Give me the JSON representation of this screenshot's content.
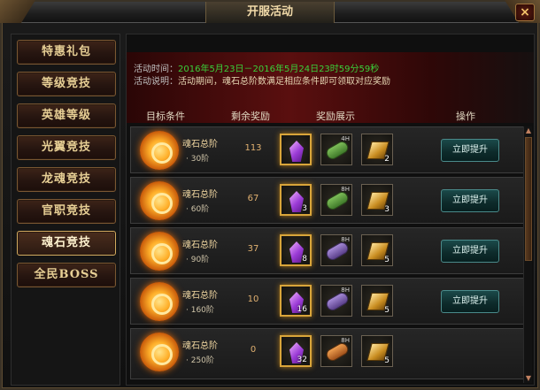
{
  "window": {
    "title": "开服活动",
    "close_label": "×"
  },
  "sidebar": {
    "items": [
      {
        "label": "特惠礼包",
        "active": false
      },
      {
        "label": "等级竞技",
        "active": false
      },
      {
        "label": "英雄等级",
        "active": false
      },
      {
        "label": "光翼竞技",
        "active": false
      },
      {
        "label": "龙魂竞技",
        "active": false
      },
      {
        "label": "官职竞技",
        "active": false
      },
      {
        "label": "魂石竞技",
        "active": true
      },
      {
        "label": "全民BOSS",
        "active": false
      }
    ]
  },
  "activity": {
    "time_label": "活动时间：",
    "time_value": "2016年5月23日－2016年5月24日23时59分59秒",
    "desc_label": "活动说明：",
    "desc_value": "活动期间，魂石总阶数满足相应条件即可领取对应奖励"
  },
  "table": {
    "headers": {
      "condition": "目标条件",
      "remaining": "剩余奖励",
      "rewards": "奖励展示",
      "action": "操作"
    },
    "rows": [
      {
        "cond_name": "魂石总阶",
        "cond_level": "· 30阶",
        "remaining": "113",
        "items": [
          {
            "icon": "crystal-icon",
            "qty": ""
          },
          {
            "icon": "scroll-icon",
            "tag": "4H",
            "variant": "green",
            "qty": ""
          },
          {
            "icon": "gold-bar-icon",
            "qty": "2"
          }
        ],
        "action": "立即提升"
      },
      {
        "cond_name": "魂石总阶",
        "cond_level": "· 60阶",
        "remaining": "67",
        "items": [
          {
            "icon": "crystal-icon",
            "qty": "3"
          },
          {
            "icon": "scroll-icon",
            "tag": "8H",
            "variant": "green",
            "qty": ""
          },
          {
            "icon": "gold-bar-icon",
            "qty": "3"
          }
        ],
        "action": "立即提升"
      },
      {
        "cond_name": "魂石总阶",
        "cond_level": "· 90阶",
        "remaining": "37",
        "items": [
          {
            "icon": "crystal-icon",
            "qty": "8"
          },
          {
            "icon": "scroll-icon",
            "tag": "8H",
            "variant": "purple",
            "qty": ""
          },
          {
            "icon": "gold-bar-icon",
            "qty": "5"
          }
        ],
        "action": "立即提升"
      },
      {
        "cond_name": "魂石总阶",
        "cond_level": "· 160阶",
        "remaining": "10",
        "items": [
          {
            "icon": "crystal-icon",
            "qty": "16"
          },
          {
            "icon": "scroll-icon",
            "tag": "8H",
            "variant": "purple",
            "qty": ""
          },
          {
            "icon": "gold-pile-icon",
            "qty": "5"
          }
        ],
        "action": "立即提升"
      },
      {
        "cond_name": "魂石总阶",
        "cond_level": "· 250阶",
        "remaining": "0",
        "items": [
          {
            "icon": "crystal-icon",
            "qty": "32"
          },
          {
            "icon": "scroll-icon",
            "tag": "8H",
            "variant": "orange",
            "qty": ""
          },
          {
            "icon": "gold-pile-icon",
            "qty": "5"
          }
        ],
        "action": ""
      }
    ]
  },
  "scrollbar": {
    "up_arrow": "▲",
    "down_arrow": "▼"
  },
  "colors": {
    "accent_gold": "#e7cf95",
    "time_green": "#3ad13a",
    "banner_red": "#5a0f0f"
  }
}
